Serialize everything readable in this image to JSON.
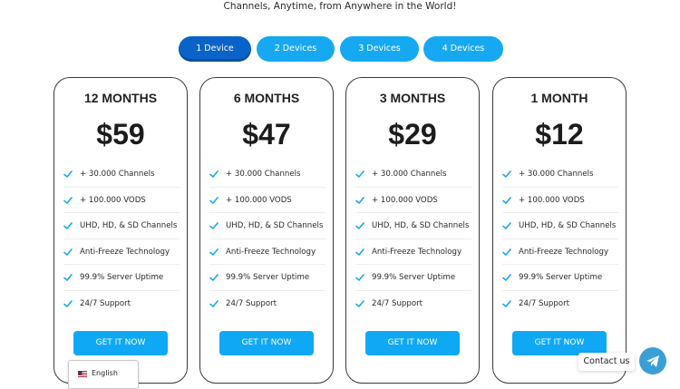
{
  "header": {
    "subtitle": "Channels, Anytime, from Anywhere in the World!"
  },
  "device_tabs": [
    {
      "label": "1 Device",
      "active": true
    },
    {
      "label": "2 Devices",
      "active": false
    },
    {
      "label": "3 Devices",
      "active": false
    },
    {
      "label": "4 Devices",
      "active": false
    }
  ],
  "plans": [
    {
      "title": "12 MONTHS",
      "price": "$59"
    },
    {
      "title": "6 MONTHS",
      "price": "$47"
    },
    {
      "title": "3 MONTHS",
      "price": "$29"
    },
    {
      "title": "1 MONTH",
      "price": "$12"
    }
  ],
  "features": [
    "+ 30.000 Channels",
    "+ 100.000 VODS",
    "UHD, HD, & SD Channels",
    "Anti-Freeze Technology",
    "99.9% Server Uptime",
    "24/7 Support"
  ],
  "cta_label": "GET IT NOW",
  "language": {
    "label": "English",
    "flag_icon": "us-flag-icon"
  },
  "contact": {
    "label": "Contact us",
    "icon": "telegram-icon"
  },
  "colors": {
    "accent": "#16a9f2",
    "active_tab": "#0a63c8",
    "cta": "#0fa8f5",
    "check": "#1aa7e8",
    "telegram": "#3b9ed6"
  }
}
